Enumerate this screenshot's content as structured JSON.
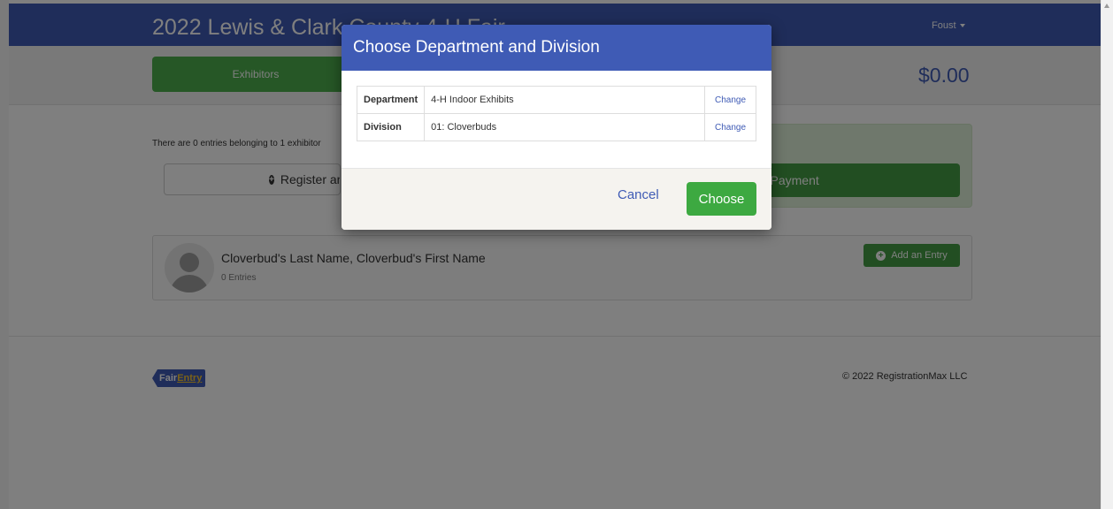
{
  "header": {
    "title": "2022 Lewis & Clark County 4-H Fair",
    "user_menu": "Foust"
  },
  "subbar": {
    "tab_exhibitors": "Exhibitors",
    "balance": "$0.00"
  },
  "main": {
    "entries_info": "There are 0 entries belonging to 1 exhibitor",
    "register_button": "Register another",
    "payment_button": "Continue to Payment",
    "exhibitor": {
      "name": "Cloverbud's Last Name, Cloverbud's First Name",
      "entries": "0 Entries",
      "add_entry_button": "Add an Entry"
    }
  },
  "footer": {
    "logo_fair": "Fair",
    "logo_entry": "Entry",
    "copyright": "© 2022 RegistrationMax LLC"
  },
  "modal": {
    "title": "Choose Department and Division",
    "rows": [
      {
        "label": "Department",
        "value": "4-H Indoor Exhibits",
        "action": "Change"
      },
      {
        "label": "Division",
        "value": "01: Cloverbuds",
        "action": "Change"
      }
    ],
    "cancel_label": "Cancel",
    "choose_label": "Choose"
  },
  "colors": {
    "brand_blue": "#3f5bb5",
    "success_green": "#4cae4c",
    "choose_green": "#3da941"
  },
  "icons": {
    "register_button": "plus-circle-icon",
    "add_entry_button": "plus-circle-icon",
    "user_menu": "caret-down-icon",
    "avatar": "user-silhouette-icon"
  }
}
